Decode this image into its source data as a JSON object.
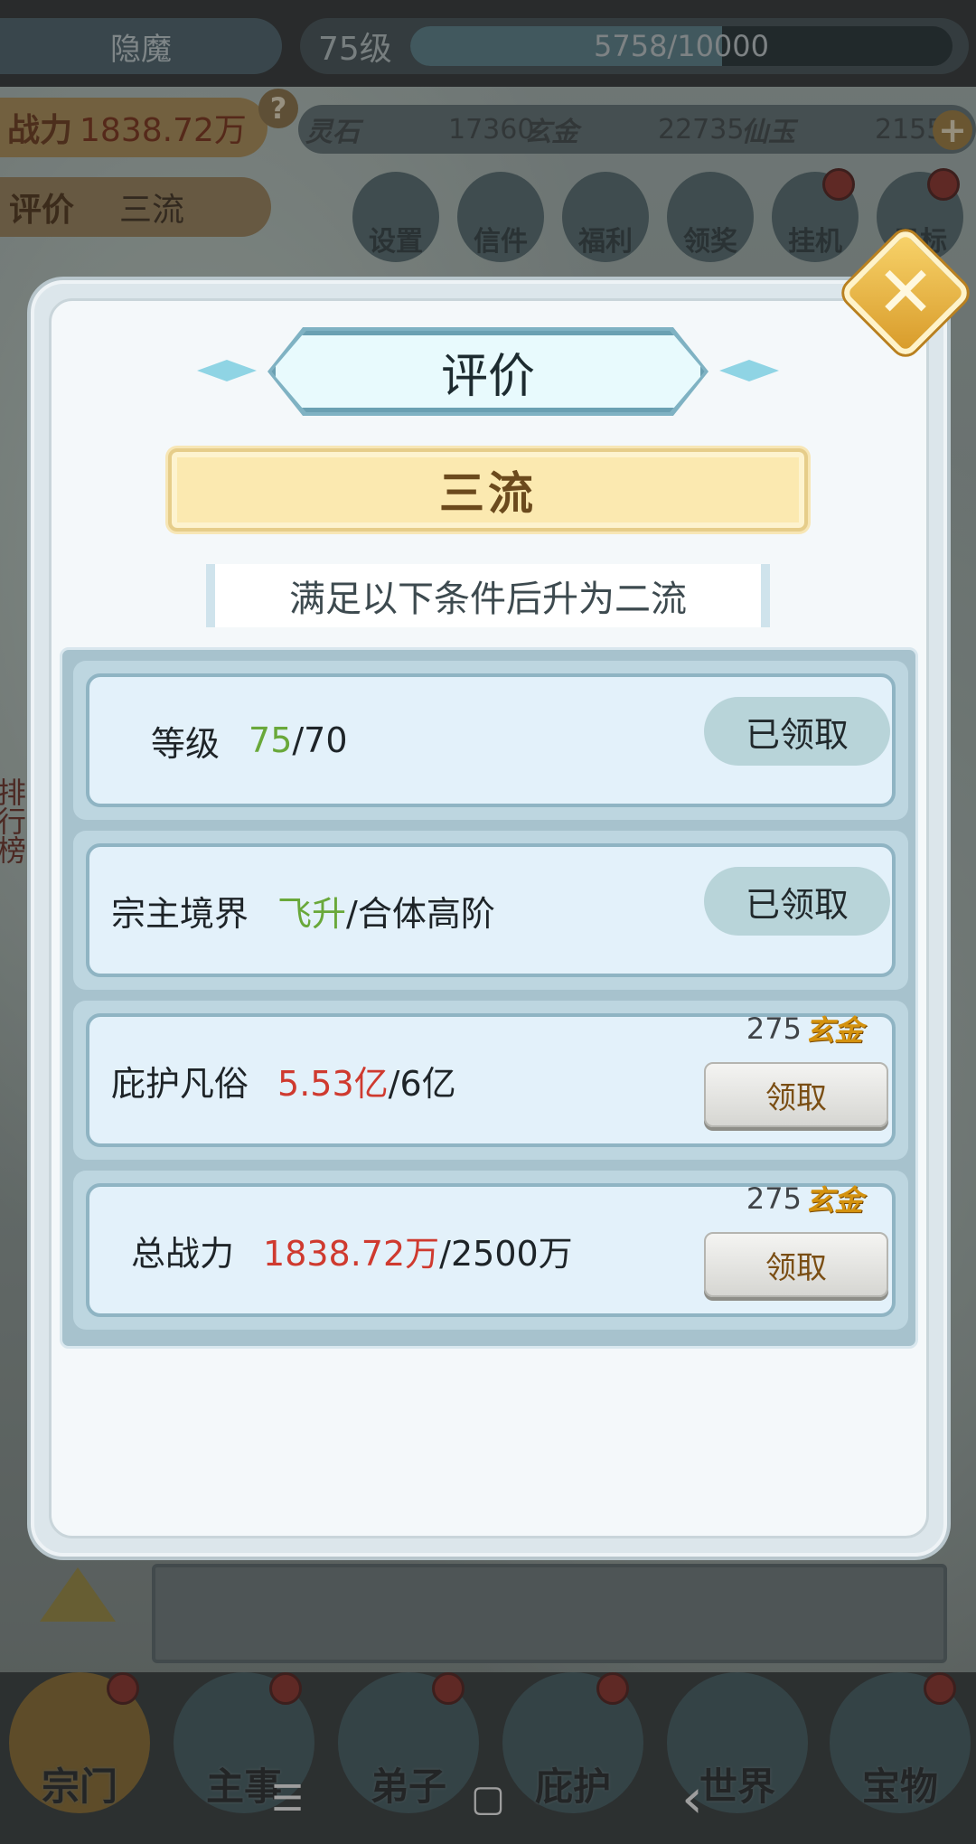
{
  "top": {
    "player_name": "隐魔",
    "level": "75级",
    "exp_text": "5758/10000",
    "exp_fraction": 0.5758,
    "power_label": "战力",
    "power_value": "1838.72万",
    "help_icon": "question-icon",
    "resources": [
      {
        "label": "灵石",
        "value": "17360"
      },
      {
        "label": "玄金",
        "value": "22735"
      },
      {
        "label": "仙玉",
        "value": "2155"
      }
    ],
    "rating_label": "评价",
    "rating_value": "三流",
    "icons": [
      {
        "label": "设置",
        "icon": "gear-icon",
        "dot": false
      },
      {
        "label": "信件",
        "icon": "mail-icon",
        "dot": false
      },
      {
        "label": "福利",
        "icon": "gift-icon",
        "dot": false
      },
      {
        "label": "领奖",
        "icon": "scroll-icon",
        "dot": false
      },
      {
        "label": "挂机",
        "icon": "afk-icon",
        "dot": true
      },
      {
        "label": "目标",
        "icon": "target-icon",
        "dot": true
      }
    ]
  },
  "side": {
    "rank_text": "排行榜"
  },
  "modal": {
    "title": "评价",
    "grade": "三流",
    "caption": "满足以下条件后升为二流",
    "conditions": [
      {
        "label": "等级",
        "current": "75",
        "target": "/70",
        "current_color": "green",
        "status": "claimed",
        "status_text": "已领取"
      },
      {
        "label": "宗主境界",
        "current": "飞升",
        "target": "/合体高阶",
        "current_color": "green",
        "status": "claimed",
        "status_text": "已领取"
      },
      {
        "label": "庇护凡俗",
        "current": "5.53亿",
        "target": "/6亿",
        "current_color": "red",
        "status": "claim",
        "reward_amount": "275",
        "reward_currency": "玄金",
        "button_text": "领取"
      },
      {
        "label": "总战力",
        "current": "1838.72万",
        "target": "/2500万",
        "current_color": "red",
        "status": "claim",
        "reward_amount": "275",
        "reward_currency": "玄金",
        "button_text": "领取"
      }
    ],
    "close_icon": "close-icon"
  },
  "nav": {
    "items": [
      {
        "label": "宗门",
        "dot": true
      },
      {
        "label": "主事",
        "dot": true
      },
      {
        "label": "弟子",
        "dot": true
      },
      {
        "label": "庇护",
        "dot": true
      },
      {
        "label": "世界",
        "dot": false
      },
      {
        "label": "宝物",
        "dot": true
      }
    ]
  },
  "system_bar": {
    "menu_icon": "☰",
    "home_icon": "▢",
    "back_icon": "‹"
  },
  "colors": {
    "accent_gold": "#d89b2a",
    "progress_green": "#69a83a",
    "progress_red": "#cf3a2f"
  }
}
